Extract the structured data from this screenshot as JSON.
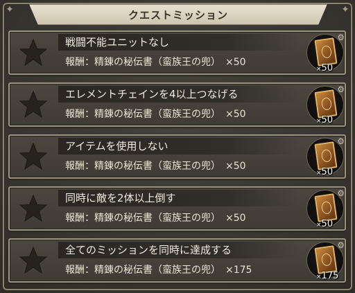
{
  "header": {
    "title": "クエストミッション"
  },
  "reward_prefix": "報酬：",
  "missions": [
    {
      "title": "戦闘不能ユニットなし",
      "reward_name": "精錬の秘伝書（蛮族王の兜）",
      "reward_qty": "×50",
      "badge_qty": "50",
      "icon": "star-icon",
      "completed": false
    },
    {
      "title": "エレメントチェインを4以上つなげる",
      "reward_name": "精錬の秘伝書（蛮族王の兜）",
      "reward_qty": "×50",
      "badge_qty": "50",
      "icon": "star-icon",
      "completed": false
    },
    {
      "title": "アイテムを使用しない",
      "reward_name": "精錬の秘伝書（蛮族王の兜）",
      "reward_qty": "×50",
      "badge_qty": "50",
      "icon": "star-icon",
      "completed": false
    },
    {
      "title": "同時に敵を2体以上倒す",
      "reward_name": "精錬の秘伝書（蛮族王の兜）",
      "reward_qty": "×50",
      "badge_qty": "50",
      "icon": "star-icon",
      "completed": false
    },
    {
      "title": "全てのミッションを同時に達成する",
      "reward_name": "精錬の秘伝書（蛮族王の兜）",
      "reward_qty": "×175",
      "badge_qty": "175",
      "icon": "star-icon",
      "completed": false
    }
  ],
  "badge_prefix": "×",
  "colors": {
    "panel_bg": "#3b3832",
    "frame": "#8b8470",
    "star": "#2a2723",
    "book": "#c98b3c"
  }
}
